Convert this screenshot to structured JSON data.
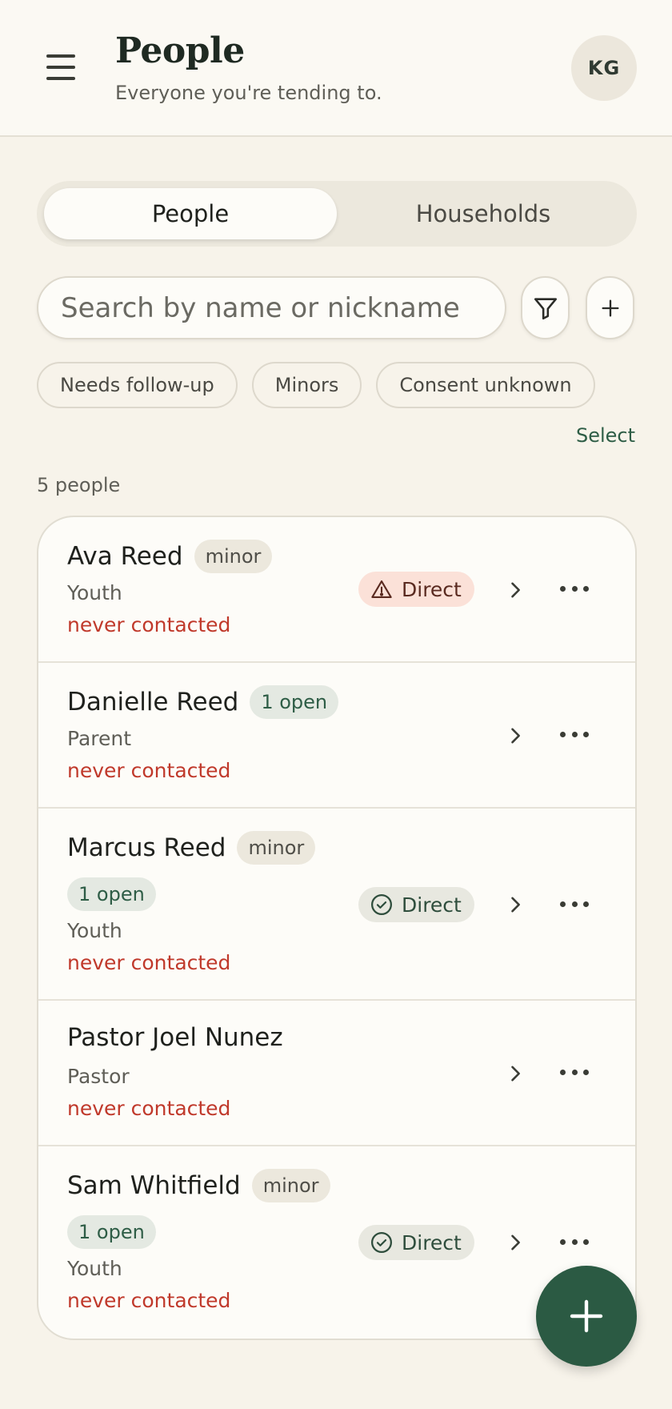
{
  "header": {
    "title": "People",
    "subtitle": "Everyone you're tending to.",
    "avatar_initials": "KG"
  },
  "tabs": [
    {
      "label": "People",
      "active": true
    },
    {
      "label": "Households",
      "active": false
    }
  ],
  "search": {
    "placeholder": "Search by name or nickname",
    "value": ""
  },
  "filters": [
    "Needs follow-up",
    "Minors",
    "Consent unknown"
  ],
  "select_label": "Select",
  "count_text": "5 people",
  "people": [
    {
      "name": "Ava Reed",
      "badge": "minor",
      "open": "",
      "role": "Youth",
      "contact": "never contacted",
      "direct": "Direct",
      "direct_status": "warning"
    },
    {
      "name": "Danielle Reed",
      "badge": "1 open",
      "open": "",
      "role": "Parent",
      "contact": "never contacted",
      "direct": "",
      "direct_status": ""
    },
    {
      "name": "Marcus Reed",
      "badge": "minor",
      "open": "1 open",
      "role": "Youth",
      "contact": "never contacted",
      "direct": "Direct",
      "direct_status": "ok"
    },
    {
      "name": "Pastor Joel Nunez",
      "badge": "",
      "open": "",
      "role": "Pastor",
      "contact": "never contacted",
      "direct": "",
      "direct_status": ""
    },
    {
      "name": "Sam Whitfield",
      "badge": "minor",
      "open": "1 open",
      "role": "Youth",
      "contact": "never contacted",
      "direct": "Direct",
      "direct_status": "ok"
    }
  ],
  "colors": {
    "accent": "#2b5a43",
    "warning_bg": "#fbe1d8",
    "never_contacted": "#c0392b",
    "background": "#f7f3ea"
  },
  "icons": {
    "menu": "hamburger-icon",
    "filter": "filter-icon",
    "add": "plus-icon",
    "warning": "warning-triangle-icon",
    "ok": "check-circle-icon",
    "row_open": "chevron-right-icon",
    "row_more": "more-horizontal-icon",
    "fab": "plus-icon"
  }
}
